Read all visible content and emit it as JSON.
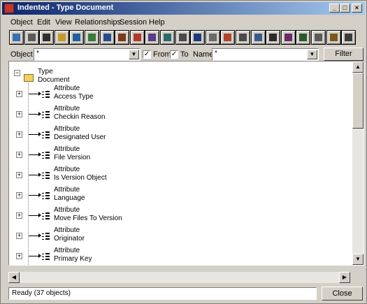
{
  "window": {
    "title": "Indented - Type Document"
  },
  "menu": [
    "Object",
    "Edit",
    "View",
    "Relationships",
    "Session",
    "Help"
  ],
  "toolbar": {
    "icons": [
      "new-document-icon",
      "open-document-icon",
      "list-icon",
      "folder-icon",
      "connect-icon",
      "properties-icon",
      "user-icon",
      "users-icon",
      "hourglass-icon",
      "book-icon",
      "monitor-icon",
      "search-icon",
      "save-icon",
      "document-icon",
      "link-icon",
      "page-icon",
      "window-icon",
      "layout-icon",
      "settings-icon",
      "hierarchy-icon",
      "eraser-icon",
      "pen-icon",
      "print-icon"
    ]
  },
  "filter": {
    "object_label": "Object",
    "object_value": "*",
    "from_label": "From",
    "from_checked": "✓",
    "to_label": "To",
    "to_checked": "✓",
    "name_label": "Name",
    "name_value": "*",
    "button_label": "Filter"
  },
  "tree": {
    "root": {
      "type": "Type",
      "name": "Document",
      "expander": "−"
    },
    "items": [
      {
        "type": "Attribute",
        "name": "Access Type",
        "expander": "+"
      },
      {
        "type": "Attribute",
        "name": "Checkin Reason",
        "expander": "+"
      },
      {
        "type": "Attribute",
        "name": "Designated User",
        "expander": "+"
      },
      {
        "type": "Attribute",
        "name": "File Version",
        "expander": "+"
      },
      {
        "type": "Attribute",
        "name": "Is Version Object",
        "expander": "+"
      },
      {
        "type": "Attribute",
        "name": "Language",
        "expander": "+"
      },
      {
        "type": "Attribute",
        "name": "Move Files To Version",
        "expander": "+"
      },
      {
        "type": "Attribute",
        "name": "Originator",
        "expander": "+"
      },
      {
        "type": "Attribute",
        "name": "Primary Key",
        "expander": "+"
      }
    ]
  },
  "status": {
    "text": "Ready (37 objects)"
  },
  "close_label": "Close",
  "colors": {
    "titlebar_start": "#0a246a",
    "titlebar_end": "#a6caf0",
    "face": "#d4d0c8"
  }
}
